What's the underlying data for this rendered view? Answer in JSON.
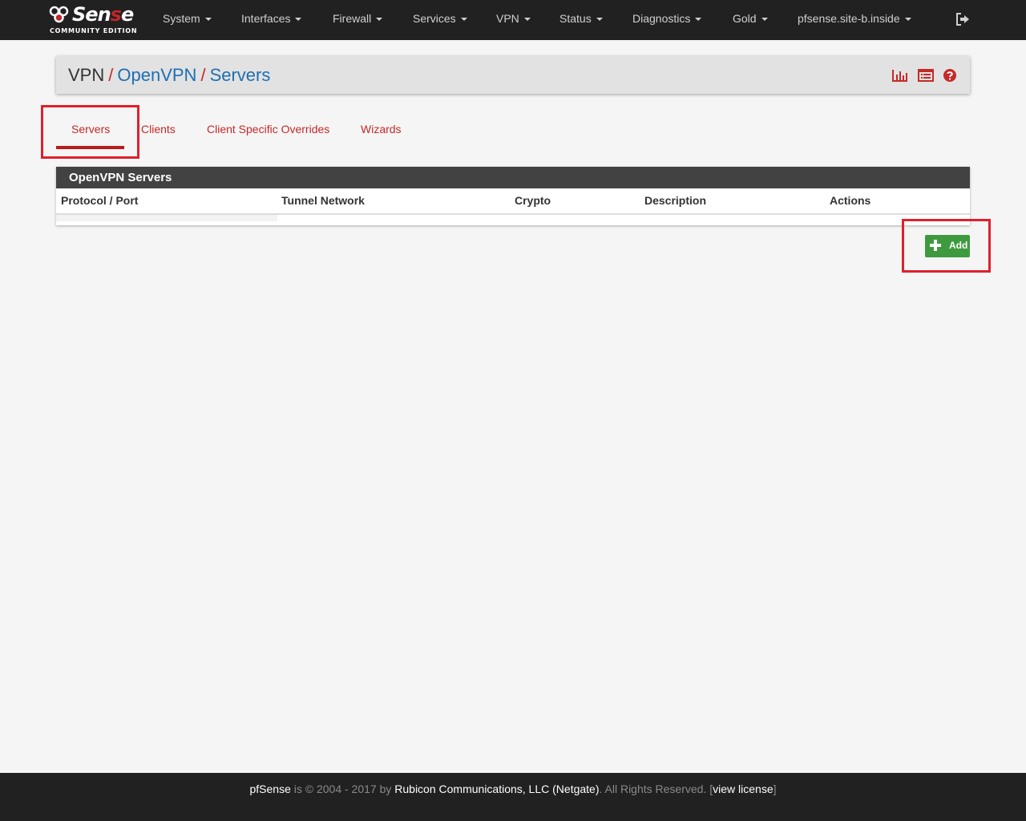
{
  "brand": {
    "logo_text_a": "Sen",
    "logo_text_b": "s",
    "logo_text_c": "e",
    "edition": "COMMUNITY EDITION",
    "accent": "#c0262a"
  },
  "nav": {
    "items": [
      {
        "label": "System"
      },
      {
        "label": "Interfaces"
      },
      {
        "label": "Firewall"
      },
      {
        "label": "Services"
      },
      {
        "label": "VPN"
      },
      {
        "label": "Status"
      },
      {
        "label": "Diagnostics"
      },
      {
        "label": "Gold"
      },
      {
        "label": "pfsense.site-b.inside"
      }
    ],
    "logout_icon": "logout-icon"
  },
  "breadcrumb": {
    "root": "VPN",
    "sep": "/",
    "level2": "OpenVPN",
    "level3": "Servers",
    "icons": [
      "bar-chart-icon",
      "list-icon",
      "help-icon"
    ]
  },
  "tabs": [
    {
      "label": "Servers",
      "active": true
    },
    {
      "label": "Clients"
    },
    {
      "label": "Client Specific Overrides"
    },
    {
      "label": "Wizards"
    }
  ],
  "servers_panel": {
    "title": "OpenVPN Servers",
    "columns": [
      "Protocol / Port",
      "Tunnel Network",
      "Crypto",
      "Description",
      "Actions"
    ],
    "rows": []
  },
  "add_button": {
    "label": "Add",
    "icon": "plus-icon",
    "color": "#3f9a3f"
  },
  "footer": {
    "product": "pfSense",
    "middle": " is © 2004 - 2017 by ",
    "company": "Rubicon Communications, LLC (Netgate)",
    "rights": ". All Rights Reserved. [",
    "license_link": "view license",
    "end": "]"
  }
}
